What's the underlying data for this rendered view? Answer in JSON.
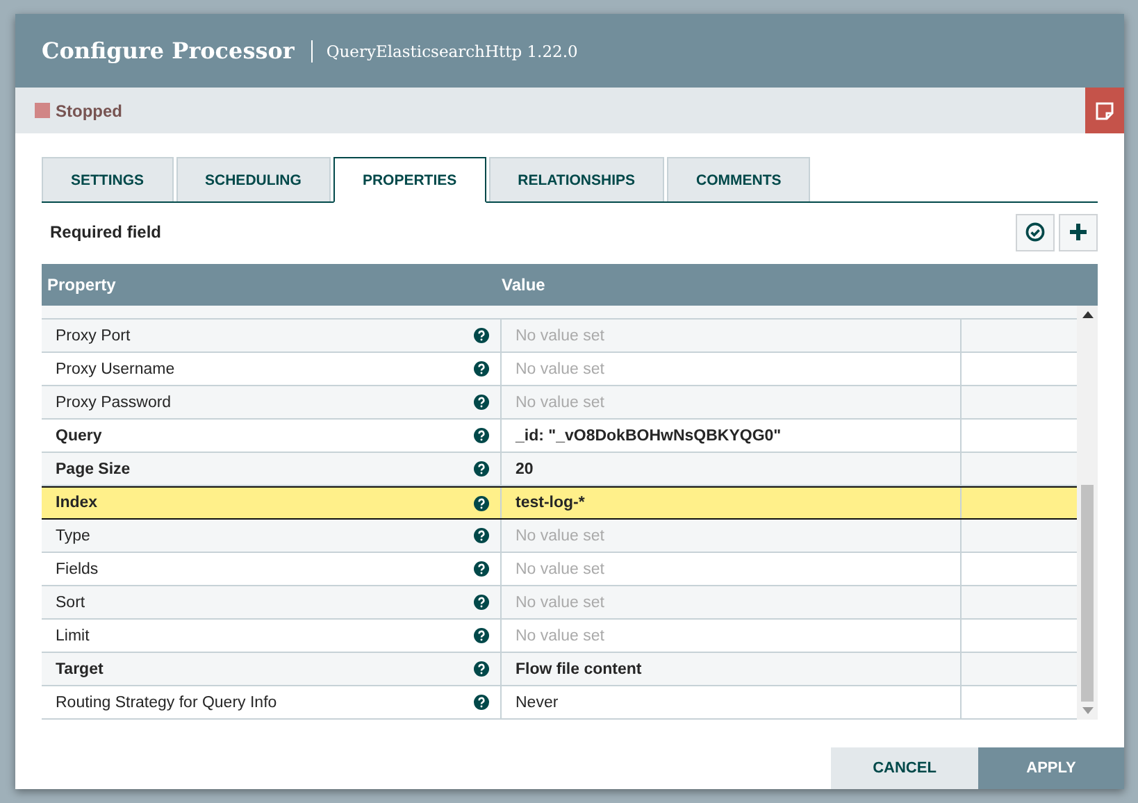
{
  "dialog": {
    "title": "Configure Processor",
    "subtitle": "QueryElasticsearchHttp 1.22.0"
  },
  "status": {
    "label": "Stopped",
    "color": "#d18686"
  },
  "tabs": [
    {
      "label": "SETTINGS",
      "selected": false
    },
    {
      "label": "SCHEDULING",
      "selected": false
    },
    {
      "label": "PROPERTIES",
      "selected": true
    },
    {
      "label": "RELATIONSHIPS",
      "selected": false
    },
    {
      "label": "COMMENTS",
      "selected": false
    }
  ],
  "required_label": "Required field",
  "table": {
    "columns": [
      "Property",
      "Value"
    ],
    "rows": [
      {
        "name": "Proxy Port",
        "required": false,
        "placeholder": "No value set",
        "selected": false
      },
      {
        "name": "Proxy Username",
        "required": false,
        "placeholder": "No value set",
        "selected": false
      },
      {
        "name": "Proxy Password",
        "required": false,
        "placeholder": "No value set",
        "selected": false
      },
      {
        "name": "Query",
        "required": true,
        "value": "_id: \"_vO8DokBOHwNsQBKYQG0\"",
        "selected": false
      },
      {
        "name": "Page Size",
        "required": true,
        "value": "20",
        "selected": false
      },
      {
        "name": "Index",
        "required": true,
        "value": "test-log-*",
        "selected": true
      },
      {
        "name": "Type",
        "required": false,
        "placeholder": "No value set",
        "selected": false
      },
      {
        "name": "Fields",
        "required": false,
        "placeholder": "No value set",
        "selected": false
      },
      {
        "name": "Sort",
        "required": false,
        "placeholder": "No value set",
        "selected": false
      },
      {
        "name": "Limit",
        "required": false,
        "placeholder": "No value set",
        "selected": false
      },
      {
        "name": "Target",
        "required": true,
        "value": "Flow file content",
        "selected": false
      },
      {
        "name": "Routing Strategy for Query Info",
        "required": false,
        "value": "Never",
        "selected": false
      }
    ]
  },
  "buttons": {
    "cancel": "CANCEL",
    "apply": "APPLY"
  }
}
